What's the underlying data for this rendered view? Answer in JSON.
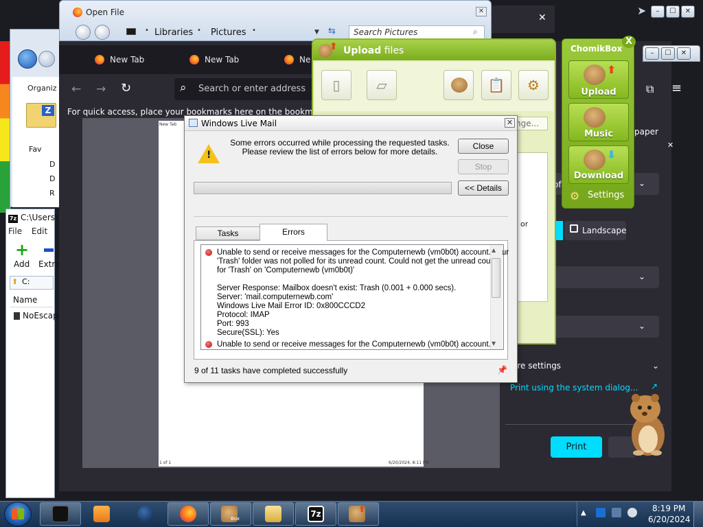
{
  "explorer": {
    "organize": "Organiz",
    "rows": [
      "Fav",
      "D",
      "D",
      "R"
    ]
  },
  "zip": {
    "title": "C:\\Users\\",
    "menu_file": "File",
    "menu_edit": "Edit",
    "add_label": "Add",
    "extract_label": "Extra",
    "addr": "C:",
    "name_header": "Name",
    "file": "NoEscap",
    "app_icon_text": "7z"
  },
  "open_file": {
    "title": "Open File",
    "crumbs": [
      "Libraries",
      "Pictures"
    ],
    "search_placeholder": "Search Pictures"
  },
  "firefox": {
    "tabs": [
      "New Tab",
      "New Tab",
      "Ne"
    ],
    "url_placeholder": "Search or enter address",
    "bookmarks_hint": "For quick access, place your bookmarks here on the bookmarks too",
    "preview_header": "New Tab",
    "preview_footer_left": "1 of 1",
    "preview_footer_right": "6/20/2024, 8:11 PM",
    "sidebar": {
      "paper_label": "paper",
      "of_label": "of",
      "landscape_label": "Landscape",
      "more_settings": "ore settings",
      "system_dialog": "Print using the system dialog...",
      "print_button": "Print"
    },
    "dark_tab_close": "✕"
  },
  "upload": {
    "title_bold": "Upload",
    "title_rest": " files",
    "change_button": "nge...",
    "or_text": "or"
  },
  "chomikbox": {
    "title": "ChomikBox",
    "upload": "Upload",
    "music": "Music",
    "download": "Download",
    "settings": "Settings"
  },
  "wlm": {
    "title": "Windows Live Mail",
    "message_line1": "Some errors occurred while processing the requested tasks.",
    "message_line2": "Please review the list of errors below for more details.",
    "close_button": "Close",
    "stop_button": "Stop",
    "details_button": "<< Details",
    "tab_tasks": "Tasks",
    "tab_errors": "Errors",
    "errors": [
      "Unable to send or receive messages for the Computernewb (vm0b0t) account. Your",
      "'Trash' folder was not polled for its unread count. Could not get the unread counts",
      "for 'Trash' on 'Computernewb (vm0b0t)'",
      "",
      "Server Response: Mailbox doesn't exist: Trash (0.001 + 0.000 secs).",
      "Server: 'mail.computernewb.com'",
      "Windows Live Mail Error ID: 0x800CCCD2",
      "Protocol: IMAP",
      "Port: 993",
      "Secure(SSL): Yes",
      "Unable to send or receive messages for the Computernewb (vm0b0t) account."
    ],
    "status": "9 of 11 tasks have completed successfully"
  },
  "taskbar": {
    "time": "8:19 PM",
    "date": "6/20/2024",
    "chomik_icon_text": "Box"
  },
  "colors": {
    "firefox_bg": "#2b2a33",
    "firefox_accent": "#00ddff",
    "chomik_green": "#8cb52a",
    "warning_yellow": "#f3c21b",
    "error_red": "#c71e1e"
  }
}
